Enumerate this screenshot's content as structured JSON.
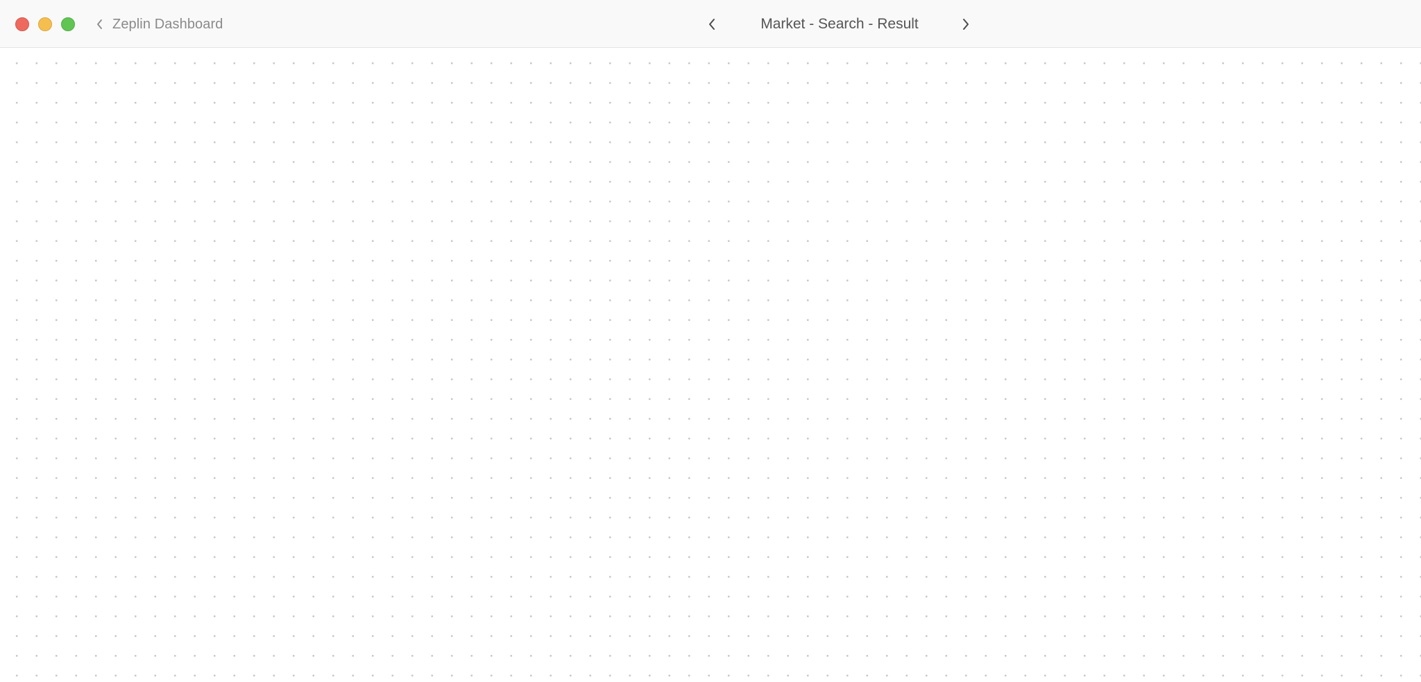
{
  "window": {
    "traffic_lights": {
      "close_color": "#ee6a5f",
      "minimize_color": "#f5bf4f",
      "zoom_color": "#61c554"
    }
  },
  "toolbar": {
    "back_label": "Zeplin Dashboard",
    "back_icon": "chevron-left-icon",
    "screen_title": "Market - Search - Result",
    "prev_icon": "chevron-left-icon",
    "next_icon": "chevron-right-icon"
  },
  "canvas": {
    "background": "dot-grid"
  }
}
